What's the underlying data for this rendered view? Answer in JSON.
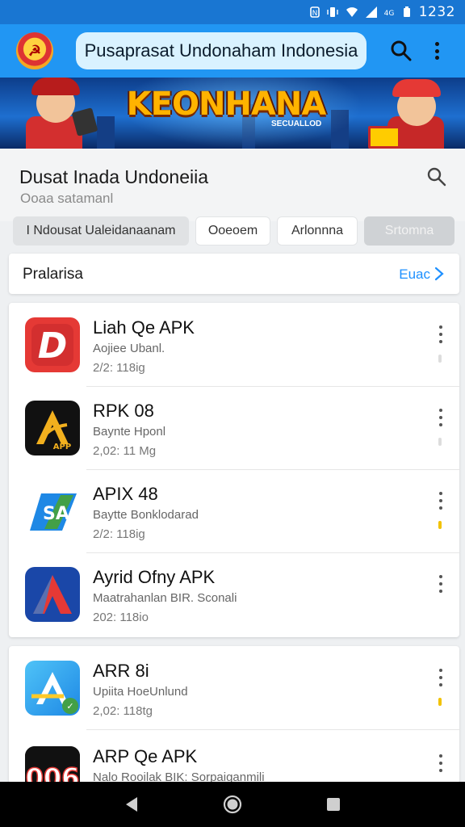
{
  "status_bar": {
    "time": "1232",
    "icons": [
      "nfc-icon",
      "vibrate-icon",
      "wifi-icon",
      "signal-icon",
      "data-icon",
      "battery-icon"
    ]
  },
  "app_bar": {
    "title": "Pusaprasat Undonaham Indonesia",
    "icons": [
      "emblem-logo",
      "search-icon",
      "more-vert-icon"
    ]
  },
  "banner": {
    "title": "KEONHANA",
    "subtitle": "SECUALLOD"
  },
  "section": {
    "title": "Dusat Inada Undoneiia",
    "subtitle": "Ooaa satamanl"
  },
  "chips": [
    {
      "label": "I Ndousat Ualeidanaanam",
      "state": "selected"
    },
    {
      "label": "Ooeoem",
      "state": "normal"
    },
    {
      "label": "Arlonnna",
      "state": "normal"
    },
    {
      "label": "Srtomna",
      "state": "disabled"
    }
  ],
  "featured": {
    "label": "Pralarisa",
    "link": "Euac"
  },
  "apps": [
    {
      "title": "Liah Qe APK",
      "subtitle": "Aojiee Ubanl.",
      "meta": "2/2: 118ig",
      "icon": "red-d-app-icon",
      "accent": "#e53935"
    },
    {
      "title": "RPK 08",
      "subtitle": "Baynte Hponl",
      "meta": "2,02: 11 Mg",
      "icon": "gold-a-app-icon",
      "accent": "#f2b01e"
    },
    {
      "title": "APIX 48",
      "subtitle": "Baytte Bonklodarad",
      "meta": "2/2: 118ig",
      "icon": "green-a-app-icon",
      "accent": "#f2c200"
    },
    {
      "title": "Ayrid Ofny APK",
      "subtitle": "Maatrahanlan BIR. Sconali",
      "meta": "202: 118io",
      "icon": "triangle-a-app-icon",
      "accent": "#e53935"
    },
    {
      "title": "ARR 8i",
      "subtitle": "Upiita HoeUnlund",
      "meta": "2,02: 118tg",
      "icon": "blue-a-app-icon",
      "accent": "#f2c200"
    },
    {
      "title": "ARP Qe APK",
      "subtitle": "Nalo Rooilak BIK: Sorpaiganmili",
      "meta": "",
      "icon": "006-app-icon",
      "accent": "#f2c200"
    }
  ],
  "nav_bar": {
    "icons": [
      "back-icon",
      "home-icon",
      "recents-icon"
    ]
  }
}
